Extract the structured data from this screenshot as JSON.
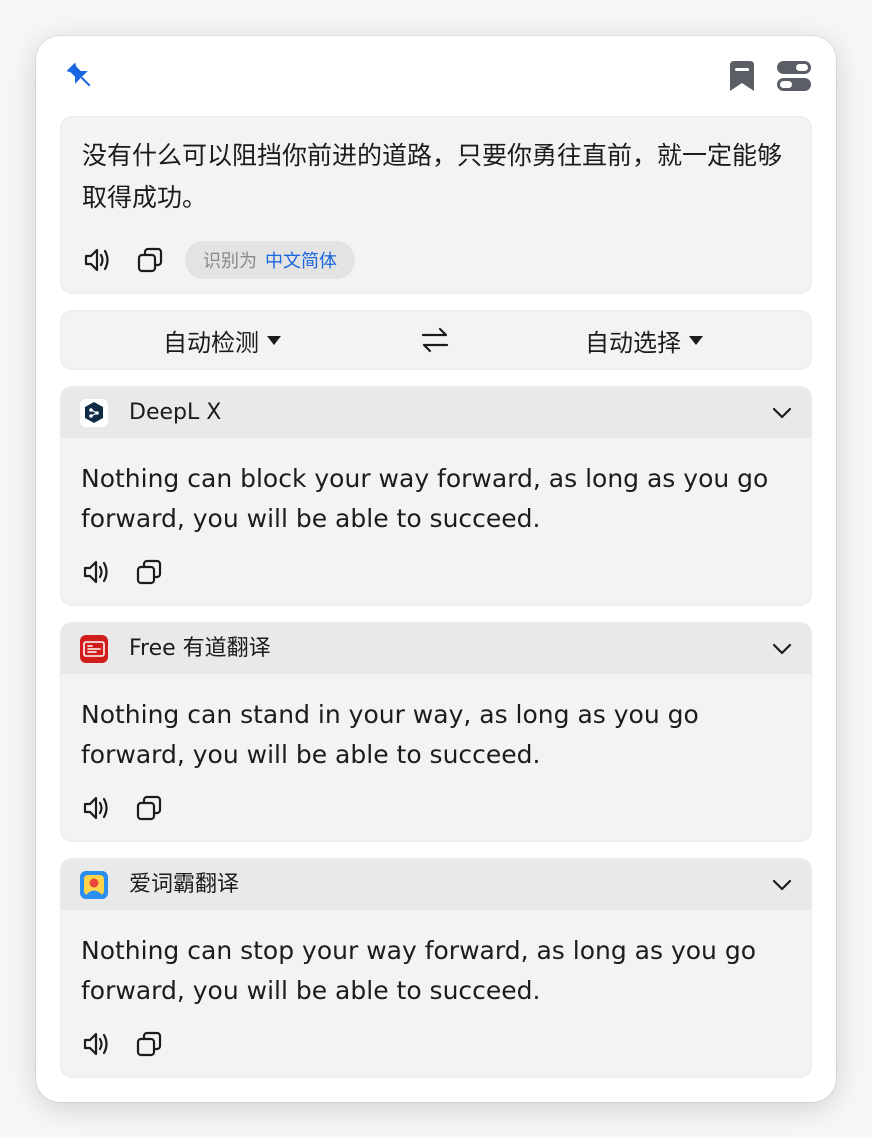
{
  "colors": {
    "accent": "#1a66e0",
    "text": "#1c1c1c",
    "muted": "#8a8a8a",
    "card_bg": "#f3f3f3",
    "card_header_bg": "#e9e9e9"
  },
  "toolbar": {
    "pin_icon": "pin-icon",
    "bookmark_icon": "bookmark-icon",
    "settings_icon": "toggles-icon"
  },
  "source": {
    "text": "没有什么可以阻挡你前进的道路，只要你勇往直前，就一定能够取得成功。",
    "detected_prefix": "识别为",
    "detected_language": "中文简体"
  },
  "language_bar": {
    "source_language": "自动检测",
    "target_language": "自动选择"
  },
  "results": [
    {
      "service": "DeepL X",
      "icon": "deepl-logo-icon",
      "text": "Nothing can block your way forward, as long as you go forward, you will be able to succeed."
    },
    {
      "service": "Free 有道翻译",
      "icon": "youdao-logo-icon",
      "text": "Nothing can stand in your way, as long as you go forward, you will be able to succeed."
    },
    {
      "service": "爱词霸翻译",
      "icon": "iciba-logo-icon",
      "text": "Nothing can stop your way forward, as long as you go forward, you will be able to succeed."
    }
  ]
}
